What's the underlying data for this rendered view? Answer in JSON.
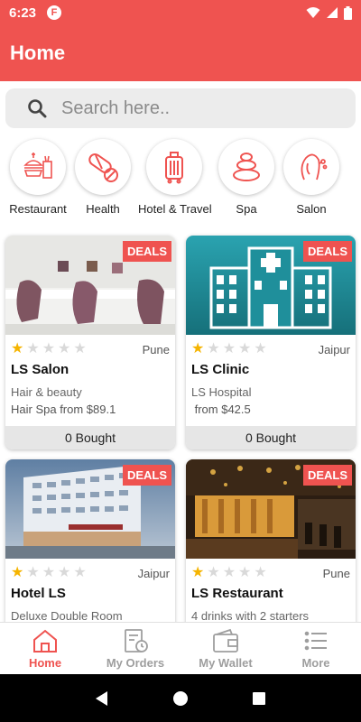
{
  "status_bar": {
    "time": "6:23",
    "app_badge": "F"
  },
  "app_bar": {
    "title": "Home"
  },
  "search": {
    "placeholder": "Search here.."
  },
  "categories": [
    {
      "label": "Restaurant",
      "icon": "restaurant-icon"
    },
    {
      "label": "Health",
      "icon": "pill-icon"
    },
    {
      "label": "Hotel & Travel",
      "icon": "luggage-icon"
    },
    {
      "label": "Spa",
      "icon": "spa-stones-icon"
    },
    {
      "label": "Salon",
      "icon": "salon-face-icon"
    }
  ],
  "badge_label": "DEALS",
  "deals": [
    {
      "title": "LS Salon",
      "city": "Pune",
      "rating": 1,
      "rating_max": 5,
      "subtitle": "Hair & beauty",
      "price": "Hair Spa from $89.1",
      "bought": "0 Bought"
    },
    {
      "title": "LS Clinic",
      "city": "Jaipur",
      "rating": 1,
      "rating_max": 5,
      "subtitle": "LS Hospital",
      "price": " from $42.5",
      "bought": "0 Bought"
    },
    {
      "title": "Hotel LS",
      "city": "Jaipur",
      "rating": 1,
      "rating_max": 5,
      "subtitle": "Deluxe Double Room"
    },
    {
      "title": "LS Restaurant",
      "city": "Pune",
      "rating": 1,
      "rating_max": 5,
      "subtitle": "4 drinks with 2 starters"
    }
  ],
  "bottom_nav": [
    {
      "label": "Home",
      "icon": "home-icon",
      "active": true
    },
    {
      "label": "My Orders",
      "icon": "orders-icon",
      "active": false
    },
    {
      "label": "My Wallet",
      "icon": "wallet-icon",
      "active": false
    },
    {
      "label": "More",
      "icon": "menu-list-icon",
      "active": false
    }
  ],
  "colors": {
    "accent": "#ef5350",
    "star": "#f5b400",
    "muted": "#9e9e9e"
  }
}
